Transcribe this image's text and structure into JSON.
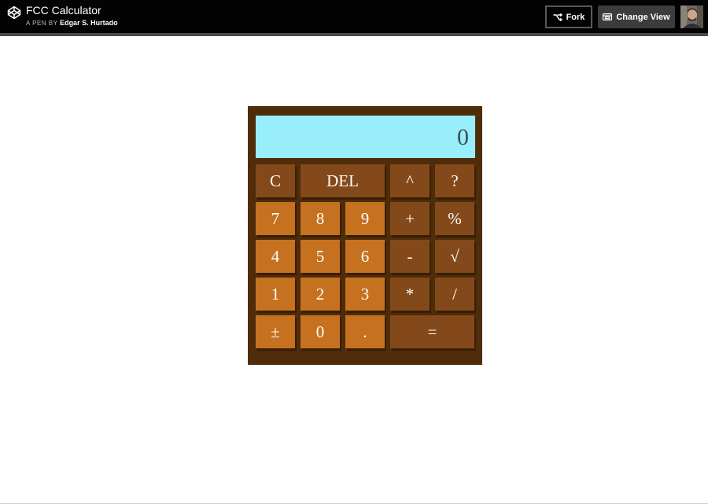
{
  "header": {
    "title": "FCC Calculator",
    "byline_prefix": "A PEN BY",
    "author": "Edgar S. Hurtado",
    "fork_label": "Fork",
    "change_view_label": "Change View"
  },
  "calculator": {
    "display_value": "0",
    "keys": {
      "clear": "C",
      "delete": "DEL",
      "power": "^",
      "help": "?",
      "seven": "7",
      "eight": "8",
      "nine": "9",
      "add": "+",
      "percent": "%",
      "four": "4",
      "five": "5",
      "six": "6",
      "subtract": "-",
      "sqrt": "√",
      "one": "1",
      "two": "2",
      "three": "3",
      "multiply": "*",
      "divide": "/",
      "negate": "±",
      "zero": "0",
      "decimal": ".",
      "equals": "="
    }
  },
  "colors": {
    "topbar": "#030303",
    "calculator_body": "#4f2c0a",
    "display_background": "#98eefb",
    "key_dark": "#84491a",
    "key_light": "#c5711f"
  },
  "icons": {
    "logo": "codepen-logo-icon",
    "fork": "fork-icon",
    "change_view": "change-view-icon",
    "avatar": "user-avatar"
  }
}
